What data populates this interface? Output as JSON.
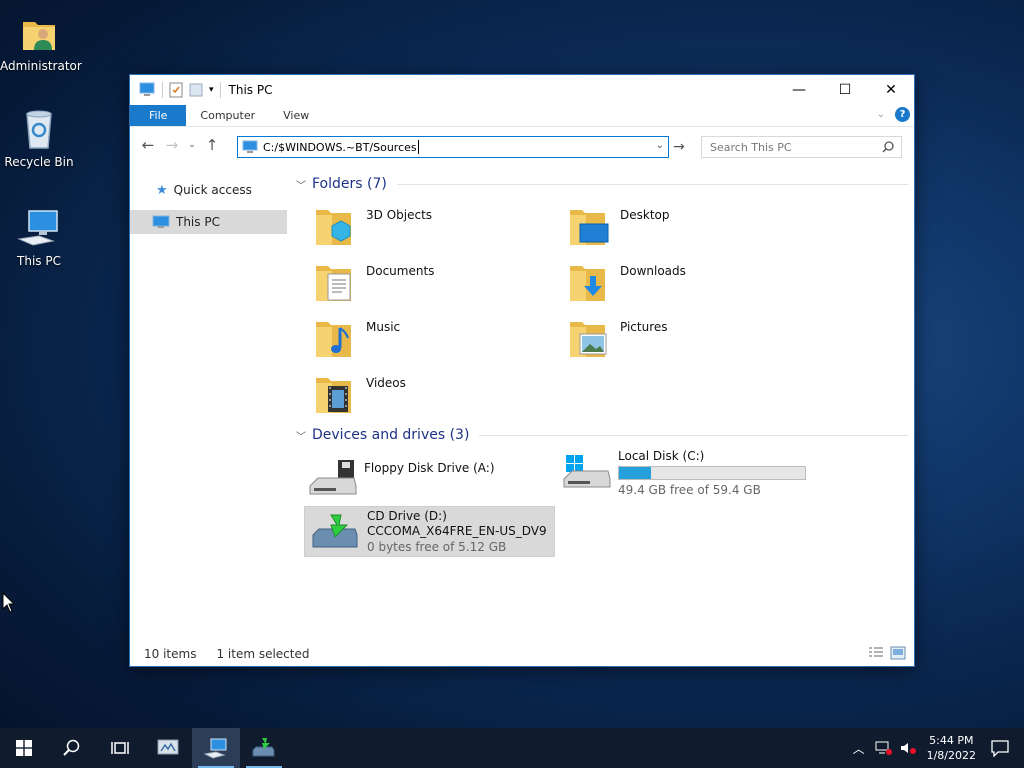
{
  "desktop": {
    "icons": [
      {
        "label": "Administrator"
      },
      {
        "label": "Recycle Bin"
      },
      {
        "label": "This PC"
      }
    ]
  },
  "window": {
    "title": "This PC",
    "controls": {
      "minimize": "—",
      "maximize": "☐",
      "close": "✕"
    }
  },
  "ribbon": {
    "tabs": [
      "File",
      "Computer",
      "View"
    ]
  },
  "address": {
    "path": "C:/$WINDOWS.~BT/Sources",
    "search_placeholder": "Search This PC"
  },
  "sidebar": {
    "items": [
      {
        "label": "Quick access"
      },
      {
        "label": "This PC"
      }
    ]
  },
  "folders": {
    "header": "Folders (7)",
    "items": [
      {
        "label": "3D Objects"
      },
      {
        "label": "Desktop"
      },
      {
        "label": "Documents"
      },
      {
        "label": "Downloads"
      },
      {
        "label": "Music"
      },
      {
        "label": "Pictures"
      },
      {
        "label": "Videos"
      }
    ]
  },
  "drives": {
    "header": "Devices and drives (3)",
    "items": [
      {
        "name": "Floppy Disk Drive (A:)"
      },
      {
        "name": "Local Disk (C:)",
        "free": "49.4 GB free of 59.4 GB",
        "used_fraction": 0.17
      },
      {
        "name": "CD Drive (D:)",
        "label": "CCCOMA_X64FRE_EN-US_DV9",
        "free": "0 bytes free of 5.12 GB"
      }
    ]
  },
  "status": {
    "items": "10 items",
    "selected": "1 item selected"
  },
  "taskbar": {
    "time": "5:44 PM",
    "date": "1/8/2022"
  },
  "colors": {
    "accent": "#1979ca",
    "folder_header": "#1e3287",
    "drive_bar": "#26a0da"
  }
}
